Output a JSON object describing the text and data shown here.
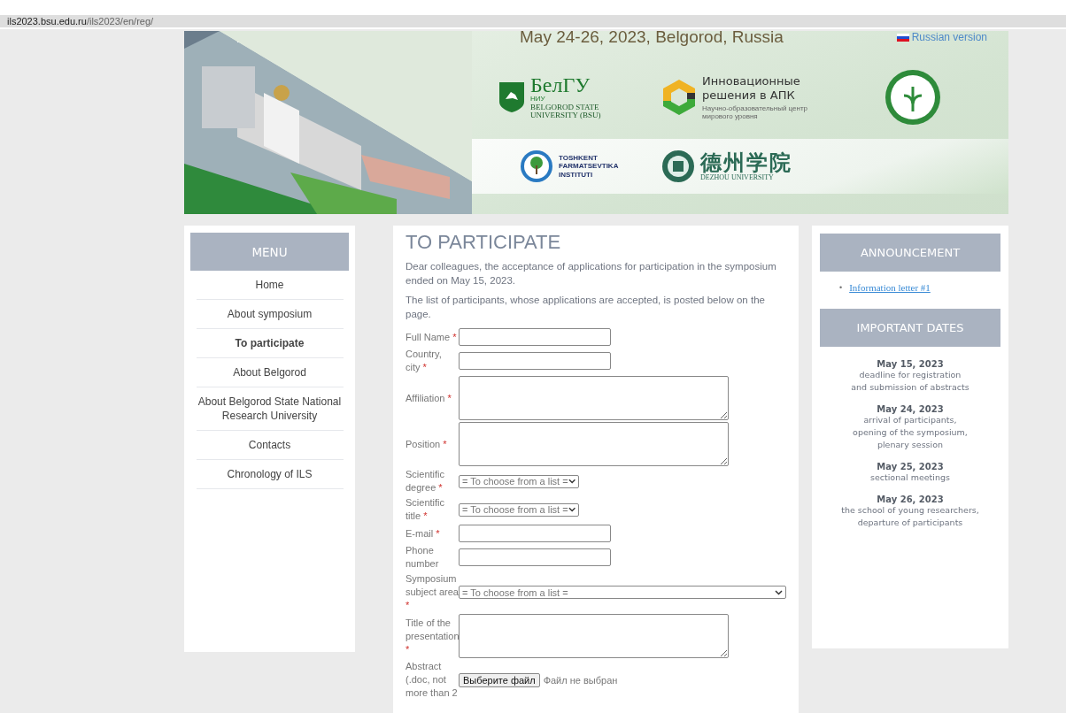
{
  "address_bar": {
    "url_host": "ils2023.bsu.edu.ru",
    "url_path": "/ils2023/en/reg/"
  },
  "banner": {
    "dates": "May 24-26, 2023, Belgorod, Russia",
    "language_link": "Russian version",
    "bsu_logo": {
      "abbr_top": "НИУ",
      "abbr": "БелГУ",
      "name": "BELGOROD STATE UNIVERSITY (BSU)"
    },
    "apk_logo": {
      "title": "Инновационные решения в АПК",
      "subtitle": "Научно-образовательный центр мирового уровня"
    },
    "tashkent_logo": {
      "name": "TOSHKENT FARMATSEVTIKA INSTITUTI"
    },
    "dezhou_logo": {
      "name_cn": "德州学院",
      "name": "DEZHOU UNIVERSITY"
    }
  },
  "menu": {
    "title": "MENU",
    "items": [
      {
        "label": "Home",
        "selected": false
      },
      {
        "label": "About symposium",
        "selected": false
      },
      {
        "label": "To participate",
        "selected": true
      },
      {
        "label": "About Belgorod",
        "selected": false
      },
      {
        "label": "About Belgorod State National Research University",
        "selected": false
      },
      {
        "label": "Contacts",
        "selected": false
      },
      {
        "label": "Chronology of ILS",
        "selected": false
      }
    ]
  },
  "content": {
    "title": "TO PARTICIPATE",
    "paragraphs": [
      "Dear colleagues, the acceptance of applications for participation in the symposium ended on May 15, 2023.",
      "The list of participants, whose applications are accepted, is posted below on the page."
    ],
    "required_mark": "*",
    "fields": [
      {
        "kind": "text",
        "label": "Full Name",
        "required": true
      },
      {
        "kind": "text",
        "label": "Country, city",
        "required": true
      },
      {
        "kind": "textarea",
        "label": "Affiliation",
        "required": true
      },
      {
        "kind": "textarea",
        "label": "Position",
        "required": true
      },
      {
        "kind": "select",
        "label": "Scientific degree",
        "required": true,
        "value": "= To choose from a list ="
      },
      {
        "kind": "select",
        "label": "Scientific title",
        "required": true,
        "value": "= To choose from a list ="
      },
      {
        "kind": "text",
        "label": "E-mail",
        "required": true
      },
      {
        "kind": "text",
        "label": "Phone number",
        "required": false
      },
      {
        "kind": "wideselect",
        "label": "Symposium subject area",
        "required": true,
        "value": "= To choose from a list ="
      },
      {
        "kind": "textarea",
        "label": "Title of the presentation",
        "required": true
      },
      {
        "kind": "file",
        "label": "Abstract (.doc, not more than 2",
        "required": false,
        "button": "Выберите файл",
        "status": "Файл не выбран"
      }
    ]
  },
  "announcement": {
    "title": "ANNOUNCEMENT",
    "bullet": "•",
    "links": [
      "Information letter #1"
    ]
  },
  "important_dates": {
    "title": "IMPORTANT DATES",
    "entries": [
      {
        "date": "May 15, 2023",
        "lines": [
          "deadline for registration",
          "and submission of abstracts"
        ]
      },
      {
        "date": "May 24, 2023",
        "lines": [
          "arrival of participants,",
          "opening of the symposium,",
          "plenary session"
        ]
      },
      {
        "date": "May 25, 2023",
        "lines": [
          "sectional meetings"
        ]
      },
      {
        "date": "May 26, 2023",
        "lines": [
          "the school of young researchers,",
          "departure of participants"
        ]
      }
    ]
  }
}
